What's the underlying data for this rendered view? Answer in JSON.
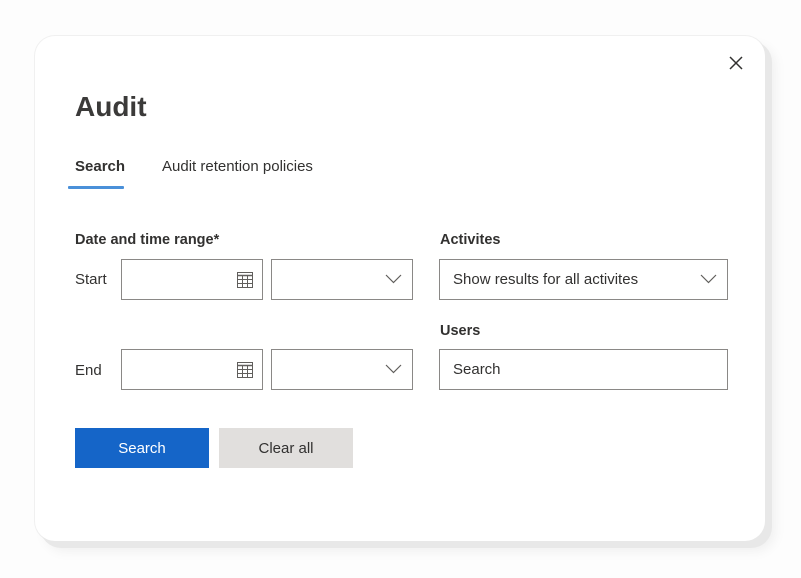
{
  "dialog": {
    "title": "Audit",
    "close_icon": "close-icon"
  },
  "tabs": [
    {
      "label": "Search",
      "active": true
    },
    {
      "label": "Audit retention policies",
      "active": false
    }
  ],
  "form": {
    "date_range_label": "Date and time range*",
    "start_label": "Start",
    "end_label": "End",
    "start_date": {
      "value": "",
      "icon": "calendar-icon"
    },
    "start_time": {
      "value": "",
      "icon": "chevron-down-icon"
    },
    "end_date": {
      "value": "",
      "icon": "calendar-icon"
    },
    "end_time": {
      "value": "",
      "icon": "chevron-down-icon"
    },
    "activities_label": "Activites",
    "activities_value": "Show results for all activites",
    "users_label": "Users",
    "users_placeholder": "Search"
  },
  "buttons": {
    "search": "Search",
    "clear_all": "Clear all"
  },
  "colors": {
    "primary": "#1565c8",
    "tab_underline": "#4a90d9",
    "secondary_button": "#e1dfdd"
  }
}
